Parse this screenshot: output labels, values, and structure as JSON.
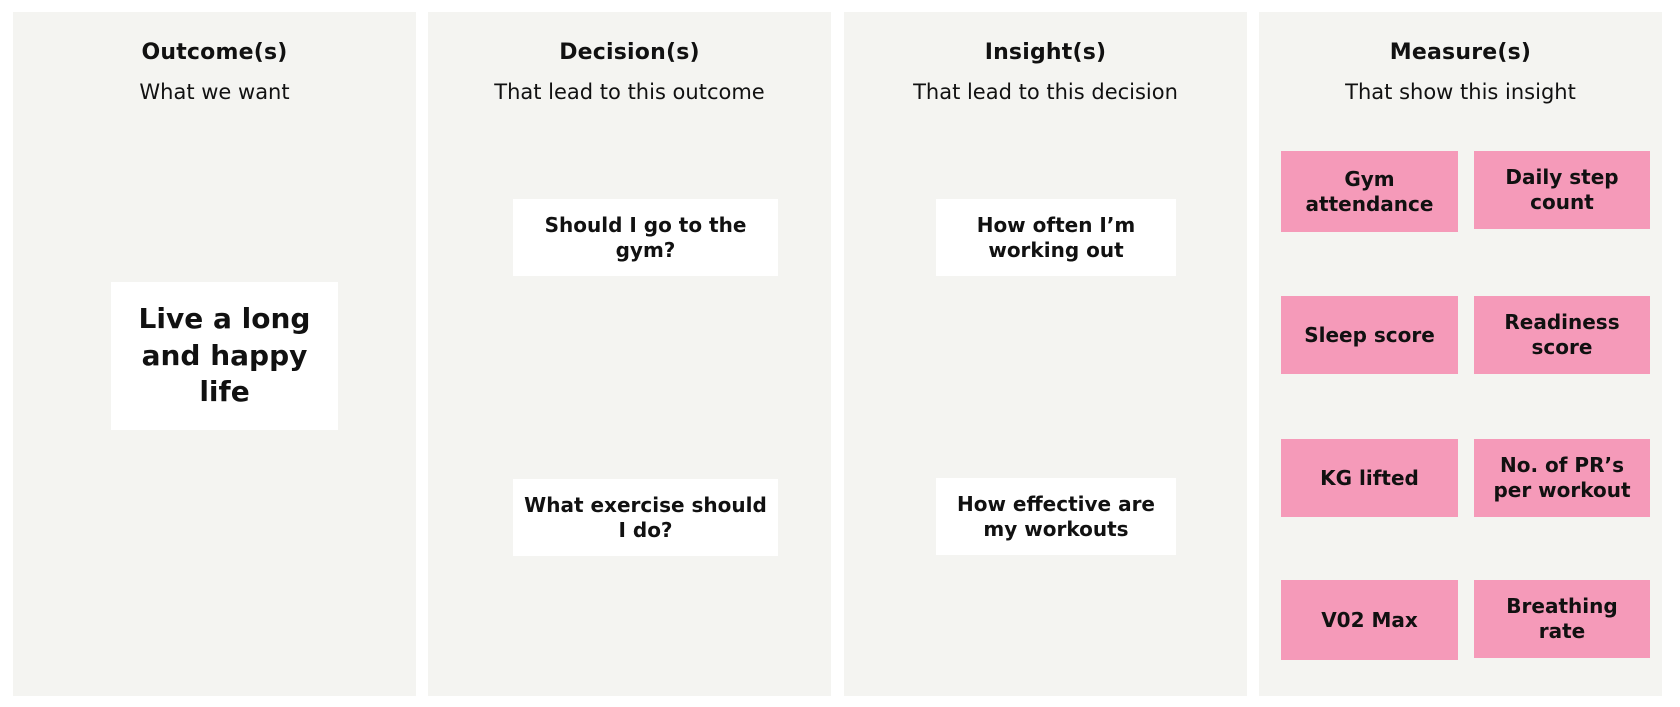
{
  "columns": [
    {
      "title": "Outcome(s)",
      "subtitle": "What we want",
      "cards": [
        {
          "text": "Live a long and happy life"
        }
      ]
    },
    {
      "title": "Decision(s)",
      "subtitle": "That lead to this outcome",
      "cards": [
        {
          "text": "Should I go to the gym?"
        },
        {
          "text": "What exercise should I do?"
        }
      ]
    },
    {
      "title": "Insight(s)",
      "subtitle": "That lead to this decision",
      "cards": [
        {
          "text": "How often I’m working out"
        },
        {
          "text": "How effective are my workouts"
        }
      ]
    },
    {
      "title": "Measure(s)",
      "subtitle": "That show this insight",
      "cards": [
        {
          "text": "Gym attendance"
        },
        {
          "text": "Daily step count"
        },
        {
          "text": "Sleep score"
        },
        {
          "text": "Readiness score"
        },
        {
          "text": "KG lifted"
        },
        {
          "text": "No. of PR’s per workout"
        },
        {
          "text": "V02 Max"
        },
        {
          "text": "Breathing rate"
        }
      ]
    }
  ],
  "colors": {
    "column_background": "#f4f4f1",
    "card_white": "#ffffff",
    "card_pink": "#f59ab9",
    "text": "#111111"
  }
}
